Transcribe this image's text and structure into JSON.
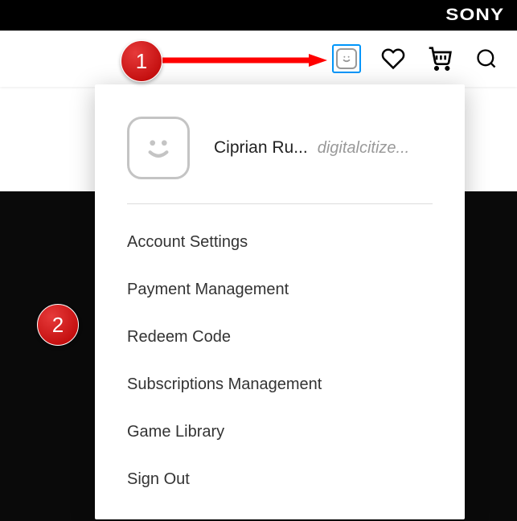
{
  "brand": {
    "logo_text": "SONY"
  },
  "nav": {
    "avatar_icon": "smiley-avatar",
    "wishlist_icon": "heart",
    "cart_icon": "cart",
    "search_icon": "search"
  },
  "dropdown": {
    "user": {
      "display_name": "Ciprian Ru...",
      "online_id": "digitalcitize..."
    },
    "items": [
      {
        "label": "Account Settings"
      },
      {
        "label": "Payment Management"
      },
      {
        "label": "Redeem Code"
      },
      {
        "label": "Subscriptions Management"
      },
      {
        "label": "Game Library"
      },
      {
        "label": "Sign Out"
      }
    ]
  },
  "annotations": {
    "badge1": "1",
    "badge2": "2"
  },
  "colors": {
    "avatar_highlight": "#0096fa",
    "badge_bg": "#c80000",
    "arrow": "#ff0000"
  }
}
